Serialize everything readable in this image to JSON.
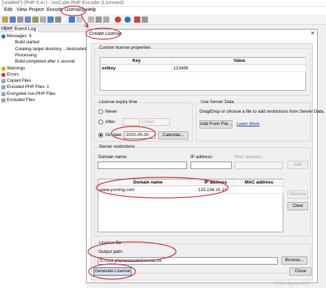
{
  "window": {
    "title": "[untitled*] (PHP 5.4+) - ionCube PHP Encoder (Licensed)"
  },
  "menu": [
    "Edit",
    "View",
    "Project",
    "Encode",
    "Licensing",
    "Help"
  ],
  "left_panel": {
    "tabs": [
      "utput",
      "Event Log"
    ],
    "log": [
      {
        "text": "Messages: 4",
        "indent": 1,
        "icon": "info-icon"
      },
      {
        "text": "Build started",
        "indent": 2,
        "icon": ""
      },
      {
        "text": "Creating target directory .../testcode\\test",
        "indent": 2,
        "icon": ""
      },
      {
        "text": "Processing",
        "indent": 2,
        "icon": ""
      },
      {
        "text": "Build completed after 1 second",
        "indent": 2,
        "icon": ""
      },
      {
        "text": "Warnings",
        "indent": 1,
        "icon": "warning-icon"
      },
      {
        "text": "Errors",
        "indent": 1,
        "icon": "error-icon"
      },
      {
        "text": "Copied Files",
        "indent": 1,
        "icon": "file-icon"
      },
      {
        "text": "Encoded PHP Files: 1",
        "indent": 1,
        "icon": "file-icon"
      },
      {
        "text": "Encrypted non-PHP Files",
        "indent": 1,
        "icon": "file-icon"
      },
      {
        "text": "Excluded Files",
        "indent": 1,
        "icon": "file-icon"
      }
    ]
  },
  "dialog": {
    "title": "Create License",
    "close_glyph": "✕",
    "custom_props": {
      "label": "Custom license properties",
      "headers": [
        "Key",
        "Value"
      ],
      "rows": [
        {
          "key": "extkey",
          "value": "123456"
        }
      ]
    },
    "expiry": {
      "label": "License expiry time",
      "never": "Never",
      "after": "After:",
      "after_unit": "Days",
      "on_date": "On date:",
      "date": "2020-05-30",
      "calendar": "Calendar..."
    },
    "server_data": {
      "label": "Use Server Data",
      "hint": "Drag/Drop or choose a file to add restrictions from Server Data.",
      "add_from_file": "Add From File...",
      "learn_more": "Learn More"
    },
    "restrictions": {
      "label": "Server restrictions",
      "domain_label": "Domain name:",
      "ip_label": "IP address:",
      "mac_label": "MAC address:",
      "add": "Add",
      "headers": [
        "Domain name",
        "IP address",
        "MAC address"
      ],
      "rows": [
        {
          "domain": "www.yuming.com",
          "ip": "125.136.15.13",
          "mac": ""
        }
      ],
      "remove": "Remove",
      "clear": "Clear"
    },
    "license_file": {
      "label": "License file",
      "output_label": "Output path:",
      "path": "D:\\root-php\\testcode\\license.txt",
      "browse": "Browse..."
    },
    "generate": "Generate License",
    "close": "Close"
  },
  "watermark": "CSDN @gugu1221",
  "colors": {
    "annotation": "#d7262b",
    "link": "#0a3ea6",
    "error": "#d23a2a",
    "info": "#2f6fd3"
  }
}
